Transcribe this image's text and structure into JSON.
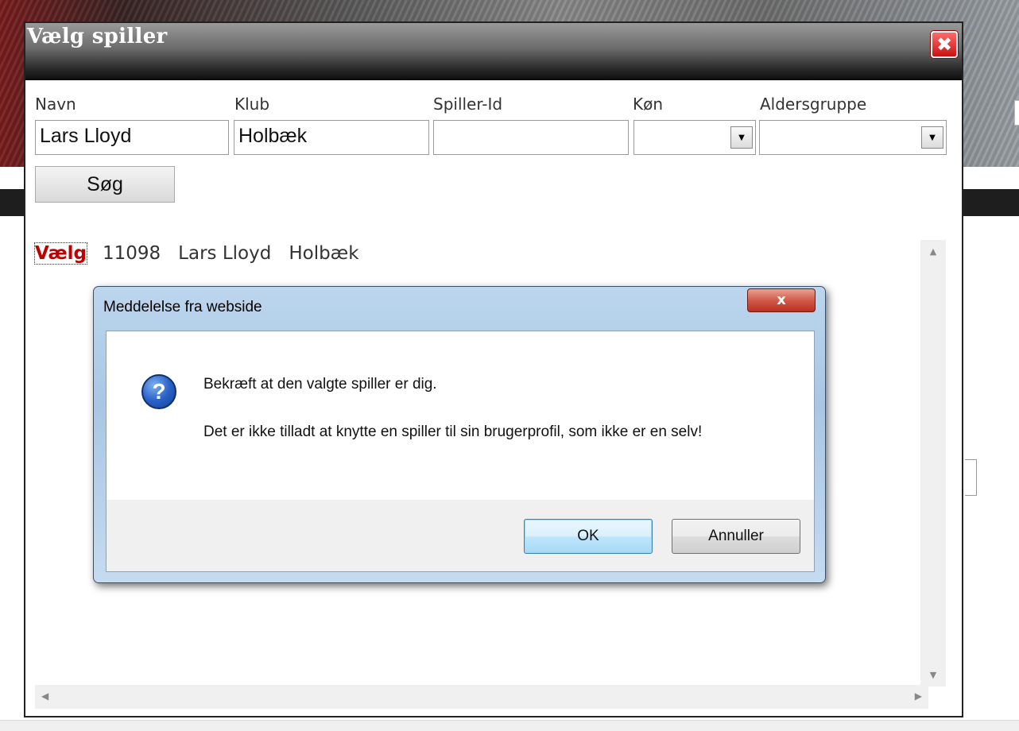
{
  "dialog": {
    "title": "Vælg spiller",
    "close_icon": "close-x-icon"
  },
  "form": {
    "labels": {
      "name": "Navn",
      "club": "Klub",
      "player_id": "Spiller-Id",
      "gender": "Køn",
      "age_group": "Aldersgruppe"
    },
    "values": {
      "name": "Lars Lloyd",
      "club": "Holbæk",
      "player_id": "",
      "gender": "",
      "age_group": ""
    },
    "search_label": "Søg"
  },
  "results": [
    {
      "select_label": "Vælg",
      "id": "11098",
      "name": "Lars Lloyd",
      "club": "Holbæk"
    }
  ],
  "message_box": {
    "title": "Meddelelse fra webside",
    "close_label": "x",
    "icon": "question-icon",
    "line1": "Bekræft at den valgte spiller er dig.",
    "line2": "Det er ikke tilladt at knytte en spiller til sin brugerprofil, som ikke er en selv!",
    "ok_label": "OK",
    "cancel_label": "Annuller"
  },
  "colors": {
    "select_link": "#c00000",
    "close_button": "#cc1010",
    "ok_border": "#3c7fb1"
  }
}
